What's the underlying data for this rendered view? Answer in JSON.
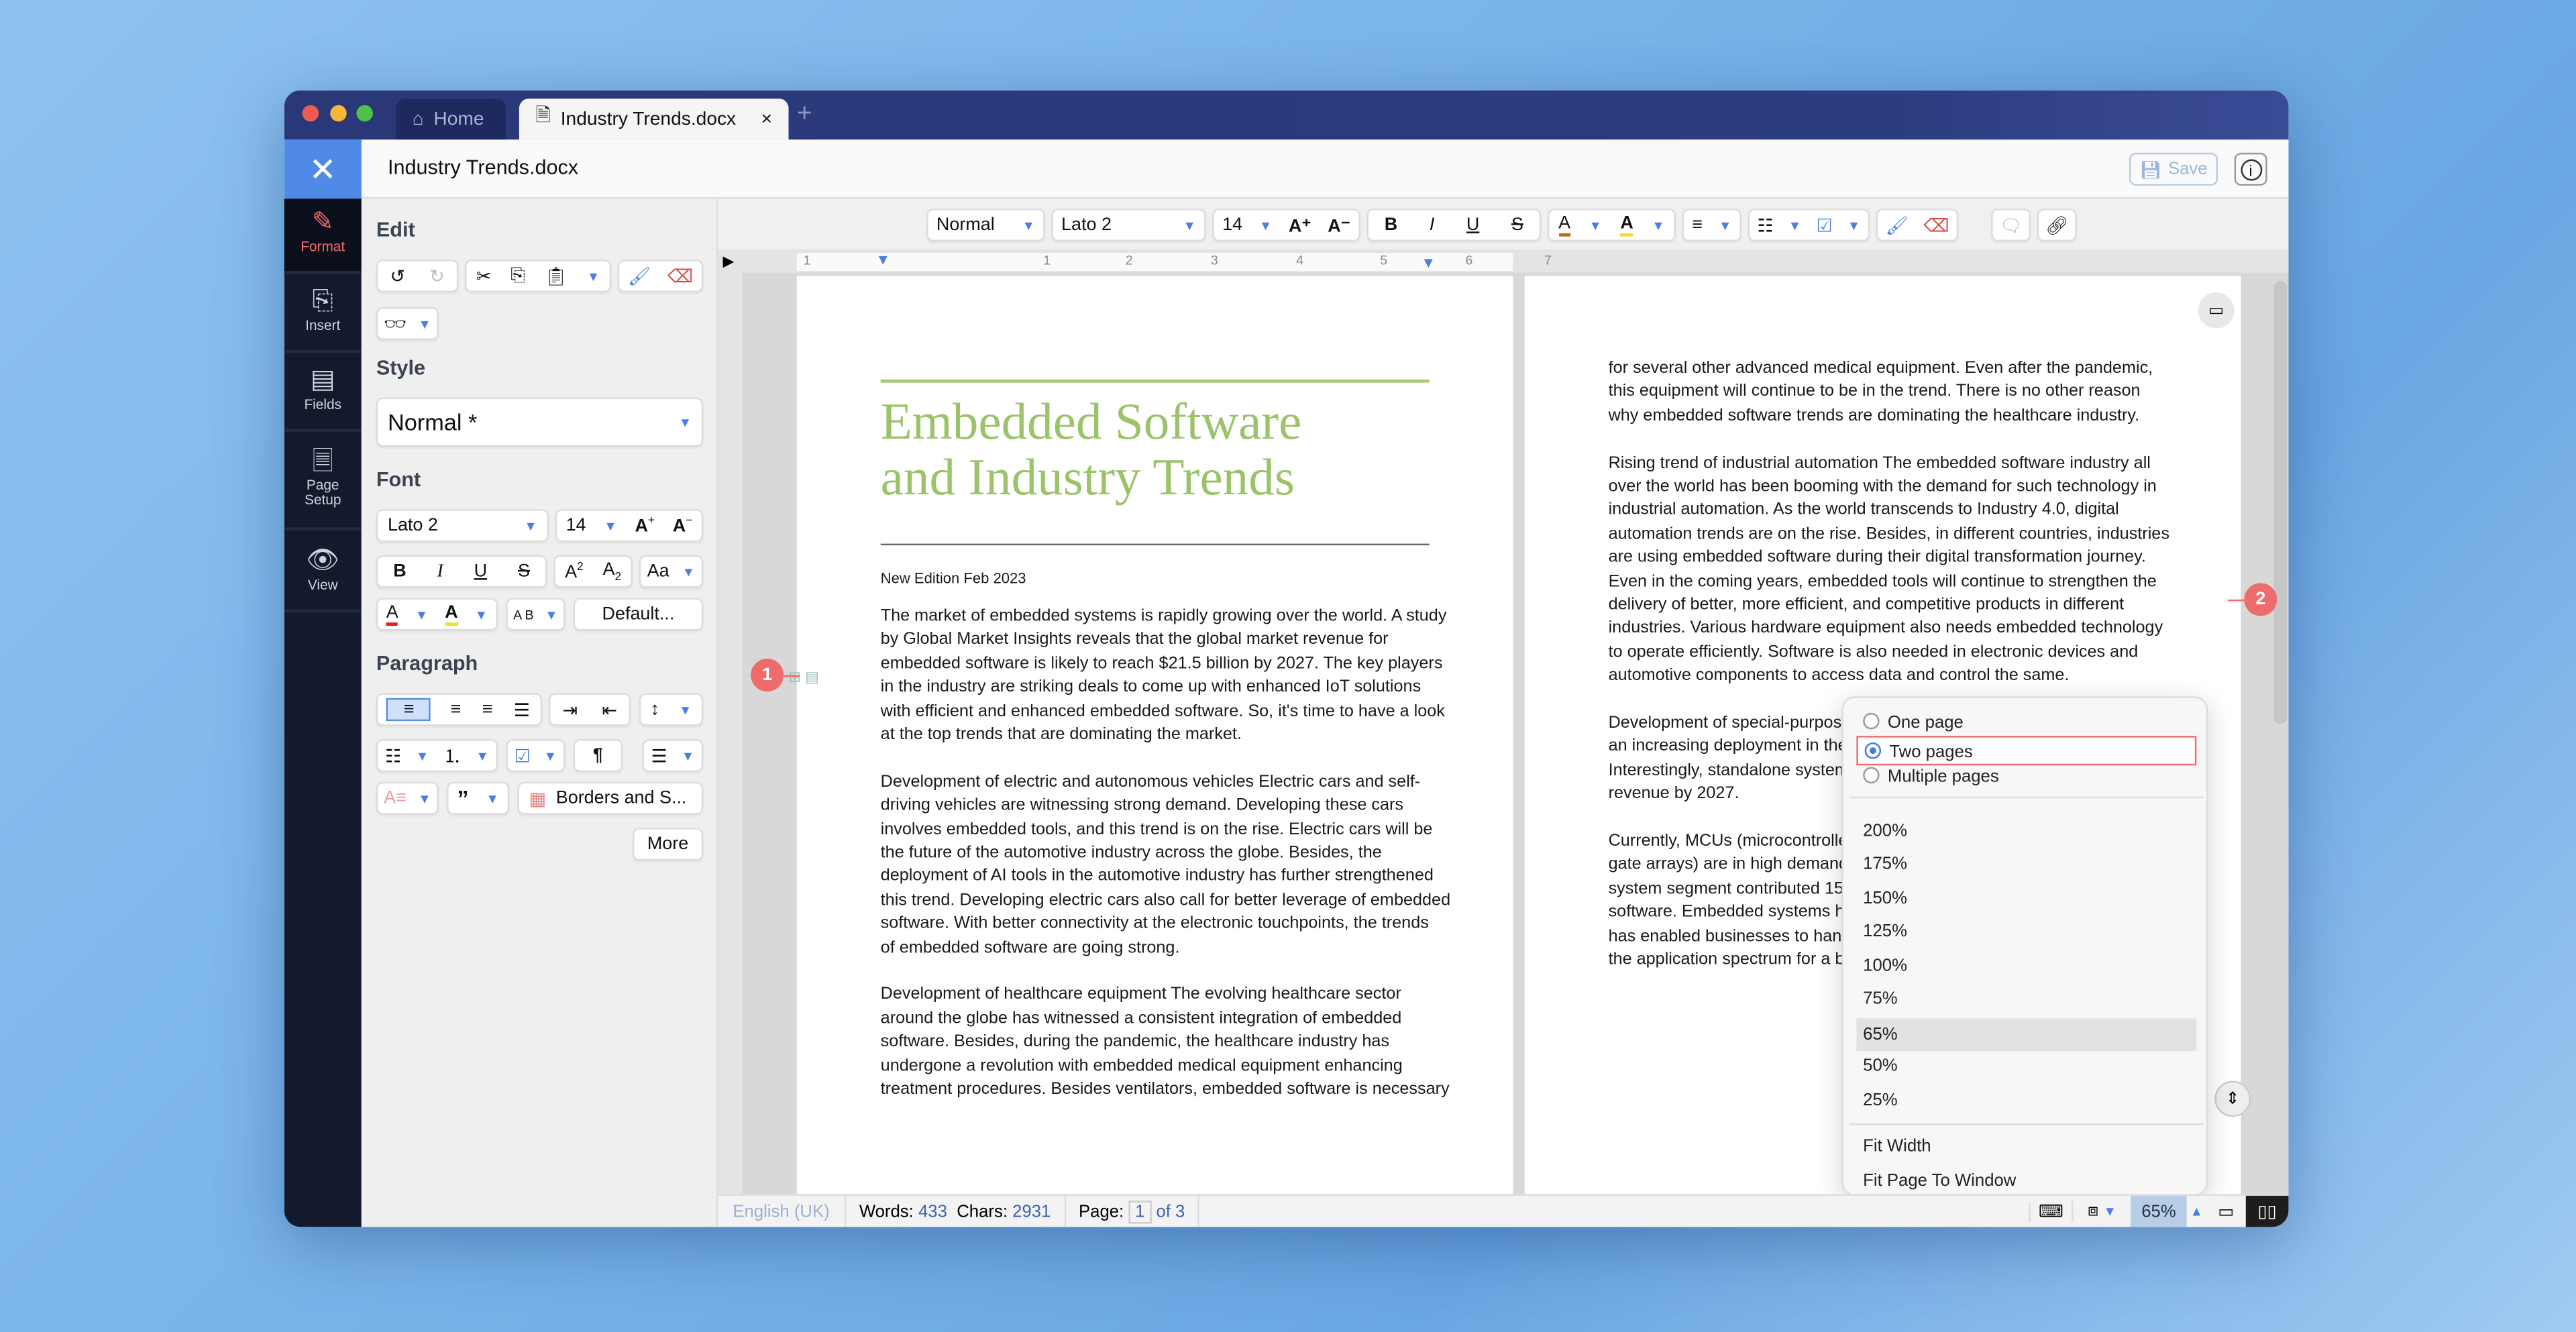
{
  "colors": {
    "accent": "#4e8ae6",
    "title_green": "#9bc36a",
    "tabbar": "#2a3878",
    "badge": "#ee6c6c",
    "format_active": "#f06e6e"
  },
  "tabs": [
    {
      "label": "Home",
      "icon": "home-icon"
    },
    {
      "label": "Industry Trends.docx",
      "icon": "document-icon",
      "close": "×"
    }
  ],
  "new_tab": "+",
  "header": {
    "close": "✕",
    "filename": "Industry Trends.docx",
    "save": "Save",
    "info": "i"
  },
  "rail": [
    {
      "label": "Format",
      "icon": "format-brush-icon"
    },
    {
      "label": "Insert",
      "icon": "insert-icon"
    },
    {
      "label": "Fields",
      "icon": "fields-icon"
    },
    {
      "label": "Page Setup",
      "icon": "page-setup-icon"
    },
    {
      "label": "View",
      "icon": "eye-icon"
    }
  ],
  "sidebar": {
    "edit": "Edit",
    "style": "Style",
    "style_value": "Normal *",
    "font": "Font",
    "font_name": "Lato 2",
    "font_size": "14",
    "default_btn": "Default...",
    "paragraph": "Paragraph",
    "borders_btn": "Borders and S...",
    "more_btn": "More"
  },
  "toolbar": {
    "style": "Normal",
    "font": "Lato 2",
    "size": "14"
  },
  "ruler_marks": [
    "1",
    "1",
    "2",
    "3",
    "4",
    "5",
    "6",
    "7"
  ],
  "page1": {
    "title_lines": [
      "Embedded Software",
      "and Industry Trends"
    ],
    "edition": "New Edition Feb 2023",
    "paragraphs": [
      [
        "The market of embedded systems is rapidly growing over the world. A study",
        "by Global Market Insights reveals that the global market revenue for",
        "embedded software is likely to reach $21.5 billion by 2027. The key players",
        "in the industry are striking deals to come up with enhanced IoT solutions",
        "with efficient and enhanced embedded software. So, it's time to have a look",
        "at the top trends that are dominating the market."
      ],
      [
        "Development of electric and autonomous vehicles Electric cars and self-",
        "driving vehicles are witnessing strong demand. Developing these cars",
        "involves embedded tools, and this trend is on the rise. Electric cars will be",
        "the future of the automotive industry across the globe. Besides, the",
        "deployment of AI tools in the automotive industry has further strengthened",
        "this trend. Developing electric cars also call for better leverage of embedded",
        "software. With better connectivity at the electronic touchpoints, the trends",
        "of embedded software are going strong."
      ],
      [
        "Development of healthcare equipment The evolving healthcare sector",
        "around the globe has witnessed a consistent integration of embedded",
        "software. Besides, during the pandemic, the healthcare industry has",
        "undergone a revolution with embedded medical equipment enhancing",
        "treatment procedures. Besides ventilators, embedded software is necessary"
      ]
    ]
  },
  "page2": {
    "paragraphs": [
      [
        "for several other advanced medical equipment. Even after the pandemic,",
        "this equipment will continue to be in the trend. There is no other reason",
        "why embedded software trends are dominating the healthcare industry."
      ],
      [
        "Rising trend of industrial automation The embedded software industry all",
        "over the world has been booming with the demand for such technology in",
        "industrial automation. As the world transcends to Industry 4.0, digital",
        "automation trends are on the rise. Besides, in different countries, industries",
        "are using embedded software during their digital transformation journey.",
        "Even in the coming years, embedded tools will continue to strengthen the",
        "delivery of better, more efficient, and competitive products in different",
        "industries. Various hardware equipment also needs embedded technology",
        "to operate efficiently. Software is also needed in electronic devices and",
        "automotive components to access data and control the same."
      ],
      [
        "Development of special-purpose",
        "an increasing deployment in the",
        "Interestingly, standalone systems",
        "revenue by 2027."
      ],
      [
        "Currently, MCUs (microcontrolle",
        "gate arrays) are in high demand a",
        "system segment contributed 159",
        "software. Embedded systems hav",
        "has enabled businesses to handl",
        "the application spectrum for a be"
      ]
    ]
  },
  "badges": [
    "1",
    "2"
  ],
  "view_menu": {
    "layouts": [
      {
        "label": "One page",
        "selected": false
      },
      {
        "label": "Two pages",
        "selected": true
      },
      {
        "label": "Multiple pages",
        "selected": false
      }
    ],
    "zooms": [
      "200%",
      "175%",
      "150%",
      "125%",
      "100%",
      "75%",
      "65%",
      "50%",
      "25%"
    ],
    "selected_zoom": "65%",
    "fit": [
      "Fit Width",
      "Fit Page To Window"
    ]
  },
  "status": {
    "language": "English (UK)",
    "words_label": "Words:",
    "words": "433",
    "chars_label": "Chars:",
    "chars": "2931",
    "page_label": "Page:",
    "page": "1",
    "page_of": "of 3",
    "zoom": "65%"
  }
}
